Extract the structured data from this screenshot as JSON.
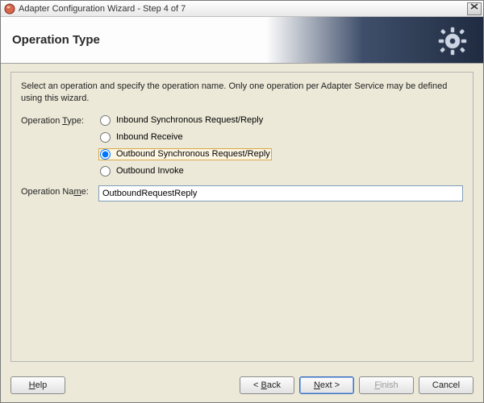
{
  "window": {
    "title": "Adapter Configuration Wizard - Step 4 of 7"
  },
  "banner": {
    "heading": "Operation Type"
  },
  "panel": {
    "instructions": "Select an operation and specify the operation name. Only one operation per Adapter Service may be defined using this wizard.",
    "operation_type_label_prefix": "Operation ",
    "operation_type_label_ul": "T",
    "operation_type_label_suffix": "ype:",
    "operation_name_label_prefix": "Operation Na",
    "operation_name_label_ul": "m",
    "operation_name_label_suffix": "e:",
    "options": [
      {
        "label": "Inbound Synchronous Request/Reply",
        "selected": false
      },
      {
        "label": "Inbound Receive",
        "selected": false
      },
      {
        "label": "Outbound Synchronous Request/Reply",
        "selected": true
      },
      {
        "label": "Outbound Invoke",
        "selected": false
      }
    ],
    "operation_name_value": "OutboundRequestReply"
  },
  "footer": {
    "help_ul": "H",
    "help_suffix": "elp",
    "back_prefix": "< ",
    "back_ul": "B",
    "back_suffix": "ack",
    "next_ul": "N",
    "next_suffix": "ext >",
    "finish_ul": "F",
    "finish_suffix": "inish",
    "cancel": "Cancel"
  }
}
